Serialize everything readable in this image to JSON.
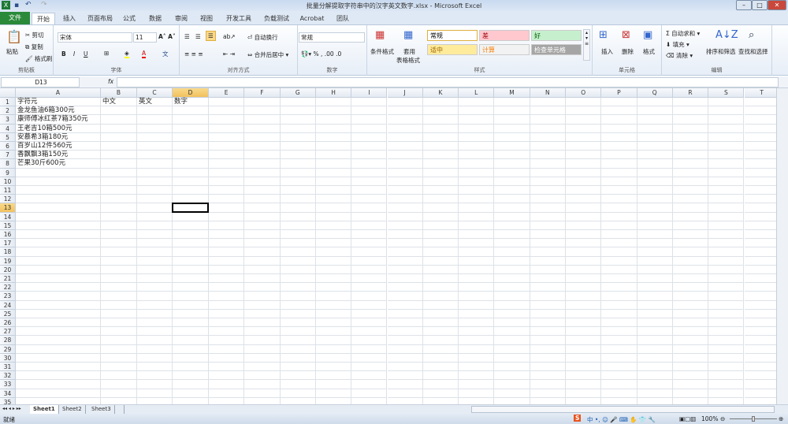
{
  "window": {
    "title": "批量分解提取字符串中的汉字英文数字.xlsx - Microsoft Excel"
  },
  "tabs": [
    "文件",
    "开始",
    "插入",
    "页面布局",
    "公式",
    "数据",
    "审阅",
    "视图",
    "开发工具",
    "负载测试",
    "Acrobat",
    "团队"
  ],
  "ribbon": {
    "clipboard": {
      "paste": "粘贴",
      "cut": "剪切",
      "copy": "复制",
      "format_painter": "格式刷",
      "label": "剪贴板"
    },
    "font": {
      "name": "宋体",
      "size": "11",
      "label": "字体"
    },
    "alignment": {
      "wrap": "自动换行",
      "merge": "合并后居中",
      "label": "对齐方式"
    },
    "number": {
      "format": "常规",
      "label": "数字"
    },
    "styles": {
      "conditional": "条件格式",
      "table1": "套用",
      "table2": "表格格式",
      "cells": [
        {
          "text": "常规",
          "bg": "#ffffff",
          "fg": "#000000"
        },
        {
          "text": "差",
          "bg": "#ffc7ce",
          "fg": "#9c0006"
        },
        {
          "text": "好",
          "bg": "#c6efce",
          "fg": "#006100"
        },
        {
          "text": "适中",
          "bg": "#ffeb9c",
          "fg": "#9c6500"
        },
        {
          "text": "计算",
          "bg": "#f2f2f2",
          "fg": "#fa7d00"
        },
        {
          "text": "检查单元格",
          "bg": "#a5a5a5",
          "fg": "#ffffff"
        }
      ],
      "label": "样式"
    },
    "cells": {
      "insert": "插入",
      "delete": "删除",
      "format": "格式",
      "label": "单元格"
    },
    "editing": {
      "autosum": "自动求和",
      "fill": "填充",
      "clear": "清除",
      "sort": "排序和筛选",
      "find": "查找和选择",
      "label": "编辑"
    }
  },
  "formula_bar": {
    "name_box": "D13",
    "fx": "fx",
    "value": ""
  },
  "columns": [
    "A",
    "B",
    "C",
    "D",
    "E",
    "F",
    "G",
    "H",
    "I",
    "J",
    "K",
    "L",
    "M",
    "N",
    "O",
    "P",
    "Q",
    "R",
    "S",
    "T"
  ],
  "active_cell": "D13",
  "cells": {
    "A1": "字符元",
    "B1": "中文",
    "C1": "英文",
    "D1": "数字",
    "A2": "金龙鱼油6箱300元",
    "A3": "康师傅冰红茶7箱350元",
    "A4": "王老吉10箱500元",
    "A5": "安慕希3箱180元",
    "A6": "百岁山12件560元",
    "A7": "香飘飘3箱150元",
    "A8": "芒果30斤600元"
  },
  "row_count": 35,
  "sheets": [
    "Sheet1",
    "Sheet2",
    "Sheet3"
  ],
  "status": {
    "ready": "就绪",
    "zoom": "100%"
  }
}
